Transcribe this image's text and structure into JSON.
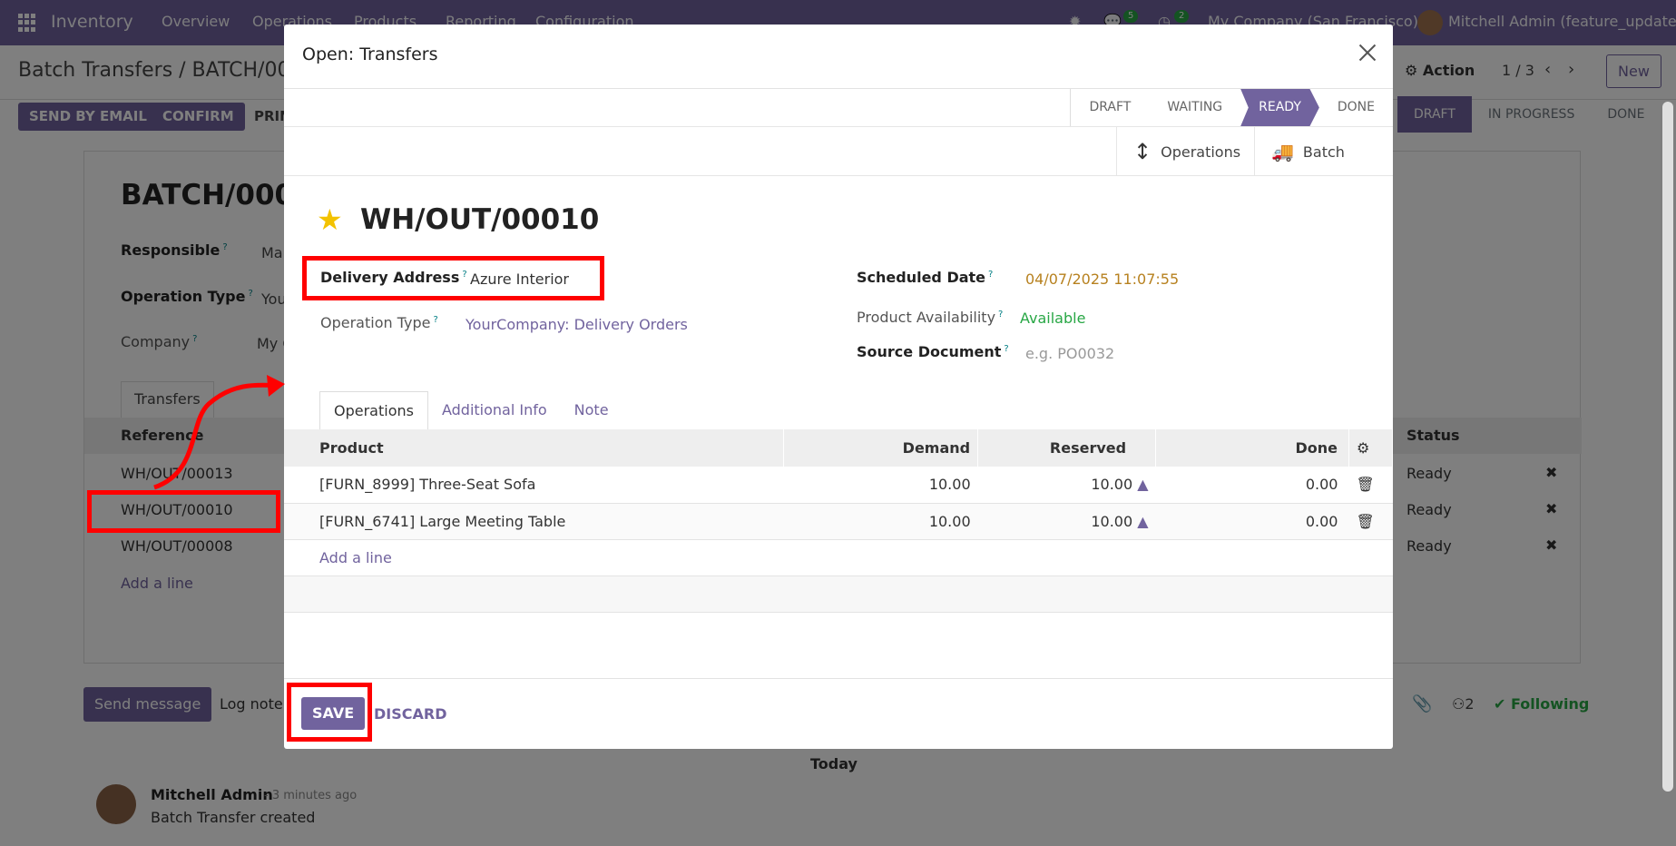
{
  "topnav": {
    "app_name": "Inventory",
    "menu": [
      "Overview",
      "Operations",
      "Products",
      "Reporting",
      "Configuration"
    ],
    "chat_count": "5",
    "activity_count": "2",
    "company": "My Company (San Francisco)",
    "user": "Mitchell Admin (feature_update)"
  },
  "control": {
    "breadcrumb": "Batch Transfers / BATCH/000",
    "action_label": "Action",
    "pager": "1 / 3",
    "new_label": "New",
    "buttons": [
      "SEND BY EMAIL",
      "CONFIRM",
      "PRIN"
    ],
    "status_steps": [
      "DRAFT",
      "IN PROGRESS",
      "DONE"
    ],
    "status_active": "DRAFT"
  },
  "batch": {
    "title": "BATCH/000",
    "responsible_label": "Responsible",
    "responsible_value": "Ma",
    "operation_type_label": "Operation Type",
    "operation_type_value": "You",
    "company_label": "Company",
    "company_value": "My C",
    "tab_transfers": "Transfers",
    "col_reference": "Reference",
    "col_status": "Status",
    "rows": [
      {
        "ref": "WH/OUT/00013",
        "status": "Ready"
      },
      {
        "ref": "WH/OUT/00010",
        "status": "Ready"
      },
      {
        "ref": "WH/OUT/00008",
        "status": "Ready"
      }
    ],
    "add_line": "Add a line"
  },
  "chatter": {
    "send_message": "Send message",
    "log_note": "Log note",
    "followers_count": "2",
    "following": "Following",
    "today": "Today",
    "author": "Mitchell Admin",
    "time": "- 3 minutes ago",
    "message": "Batch Transfer created"
  },
  "modal": {
    "title": "Open: Transfers",
    "pipeline": [
      "DRAFT",
      "WAITING",
      "READY",
      "DONE"
    ],
    "pipeline_active": "READY",
    "smart_operations": "Operations",
    "smart_batch": "Batch",
    "record_name": "WH/OUT/00010",
    "delivery_address_label": "Delivery Address",
    "delivery_address_value": "Azure Interior",
    "operation_type_label": "Operation Type",
    "operation_type_value": "YourCompany: Delivery Orders",
    "scheduled_date_label": "Scheduled Date",
    "scheduled_date_value": "04/07/2025 11:07:55",
    "availability_label": "Product Availability",
    "availability_value": "Available",
    "source_label": "Source Document",
    "source_placeholder": "e.g. PO0032",
    "tabs": [
      "Operations",
      "Additional Info",
      "Note"
    ],
    "columns": {
      "product": "Product",
      "demand": "Demand",
      "reserved": "Reserved",
      "done": "Done"
    },
    "lines": [
      {
        "product": "[FURN_8999] Three-Seat Sofa",
        "demand": "10.00",
        "reserved": "10.00",
        "done": "0.00"
      },
      {
        "product": "[FURN_6741] Large Meeting Table",
        "demand": "10.00",
        "reserved": "10.00",
        "done": "0.00"
      }
    ],
    "add_line": "Add a line",
    "save": "SAVE",
    "discard": "DISCARD"
  },
  "colors": {
    "brand": "#71639e",
    "highlight": "#ff0000",
    "date": "#b7811f",
    "available": "#28a745"
  }
}
